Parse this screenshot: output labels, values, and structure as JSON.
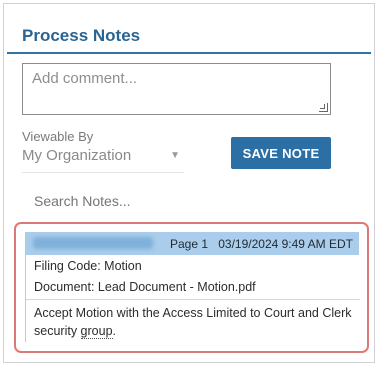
{
  "panel": {
    "title": "Process Notes"
  },
  "comment": {
    "placeholder": "Add comment..."
  },
  "viewable": {
    "label": "Viewable By",
    "selected": "My Organization"
  },
  "save_label": "SAVE NOTE",
  "search": {
    "placeholder": "Search Notes..."
  },
  "note": {
    "page": "Page 1",
    "timestamp": "03/19/2024 9:49 AM EDT",
    "filing_code": "Filing Code: Motion",
    "document": "Document: Lead Document - Motion.pdf",
    "text_before": "Accept Motion with the Access Limited to Court and Clerk security ",
    "text_underlined": "group",
    "text_after": "."
  }
}
